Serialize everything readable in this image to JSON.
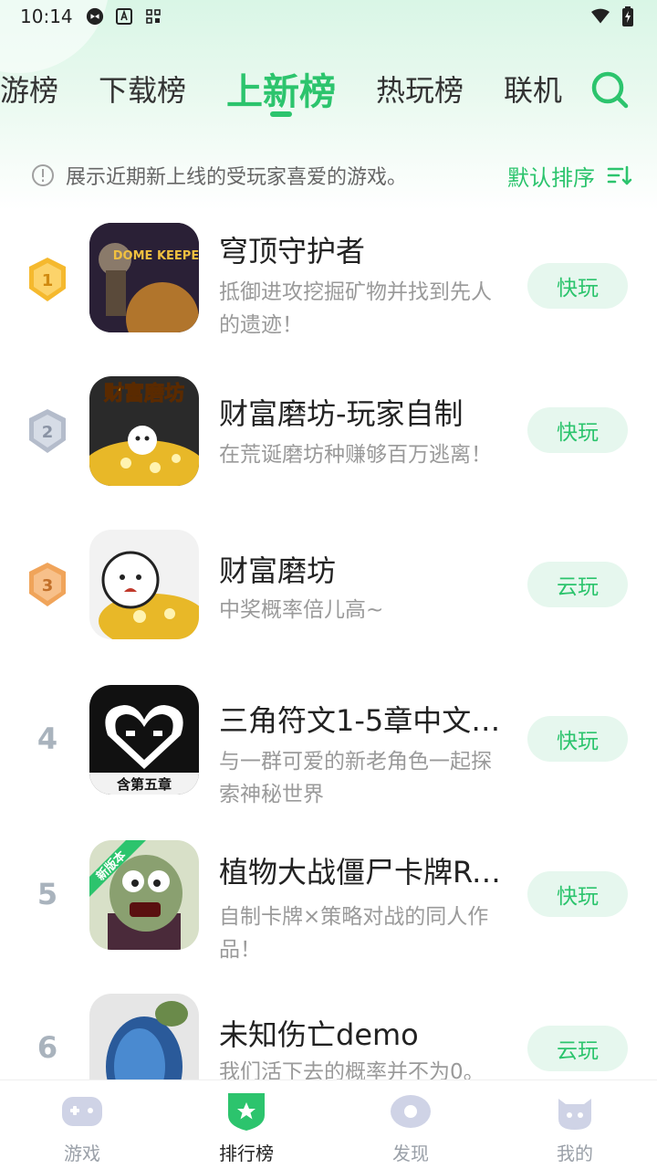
{
  "status_bar": {
    "time": "10:14"
  },
  "tabs": [
    {
      "label": "游榜"
    },
    {
      "label": "下载榜"
    },
    {
      "label": "上新榜"
    },
    {
      "label": "热玩榜"
    },
    {
      "label": "联机"
    }
  ],
  "notice": {
    "text": "展示近期新上线的受玩家喜爱的游戏。",
    "sort_label": "默认排序"
  },
  "games": [
    {
      "rank": "1",
      "title": "穹顶守护者",
      "desc": "抵御进攻挖掘矿物并找到先人的遗迹！",
      "button": "快玩",
      "icon_label": "DOME KEEPER"
    },
    {
      "rank": "2",
      "title": "财富磨坊-玩家自制",
      "desc": "在荒诞磨坊种赚够百万逃离！",
      "button": "快玩",
      "icon_label": "财富磨坊"
    },
    {
      "rank": "3",
      "title": "财富磨坊",
      "desc": "中奖概率倍儿高~",
      "button": "云玩"
    },
    {
      "rank": "4",
      "title": "三角符文1-5章中文版...",
      "desc": "与一群可爱的新老角色一起探索神秘世界",
      "button": "快玩",
      "icon_label": "含第五章"
    },
    {
      "rank": "5",
      "title": "植物大战僵尸卡牌Ro...",
      "desc": "自制卡牌×策略对战的同人作品！",
      "button": "快玩",
      "icon_label": "新版本"
    },
    {
      "rank": "6",
      "title": "未知伤亡demo",
      "desc": "我们活下去的概率并不为0。",
      "button": "云玩"
    }
  ],
  "bottom_nav": [
    {
      "label": "游戏"
    },
    {
      "label": "排行榜"
    },
    {
      "label": "发现"
    },
    {
      "label": "我的"
    }
  ],
  "colors": {
    "accent": "#2cc46d",
    "button_bg": "#e6f7ee",
    "gold": "#f5b92e",
    "silver": "#b4bccb",
    "bronze": "#f0a45a"
  }
}
